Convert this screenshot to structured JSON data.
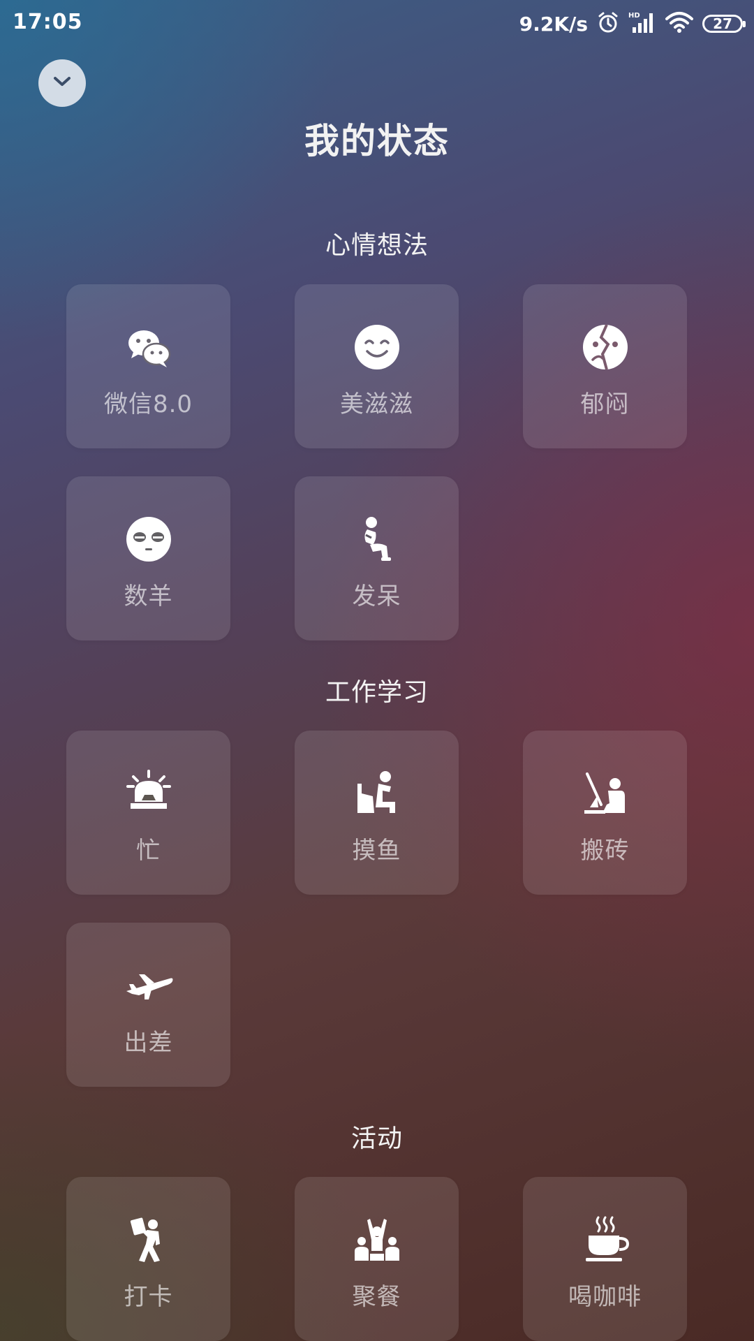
{
  "status_bar": {
    "time": "17:05",
    "net_speed": "9.2K/s",
    "battery_level": "27",
    "icons": [
      "alarm-icon",
      "hd-signal-icon",
      "wifi-icon",
      "battery-icon"
    ]
  },
  "header": {
    "collapse_icon": "chevron-down-icon",
    "title": "我的状态"
  },
  "sections": [
    {
      "title": "心情想法",
      "items": [
        {
          "label": "微信8.0",
          "icon": "wechat-icon"
        },
        {
          "label": "美滋滋",
          "icon": "smile-icon"
        },
        {
          "label": "郁闷",
          "icon": "broken-face-icon"
        },
        {
          "label": "数羊",
          "icon": "sleepy-face-icon"
        },
        {
          "label": "发呆",
          "icon": "thinker-icon"
        }
      ]
    },
    {
      "title": "工作学习",
      "items": [
        {
          "label": "忙",
          "icon": "alarm-light-icon"
        },
        {
          "label": "摸鱼",
          "icon": "person-at-desk-icon"
        },
        {
          "label": "搬砖",
          "icon": "worker-icon"
        },
        {
          "label": "出差",
          "icon": "airplane-icon"
        }
      ]
    },
    {
      "title": "活动",
      "items": [
        {
          "label": "打卡",
          "icon": "check-in-person-icon"
        },
        {
          "label": "聚餐",
          "icon": "group-cheer-icon"
        },
        {
          "label": "喝咖啡",
          "icon": "coffee-cup-icon"
        }
      ]
    }
  ],
  "colors": {
    "tile_background": "rgba(255,255,255,0.11)",
    "label_color": "rgba(255,255,255,0.62)",
    "collapse_button": "#e1e6ee"
  }
}
